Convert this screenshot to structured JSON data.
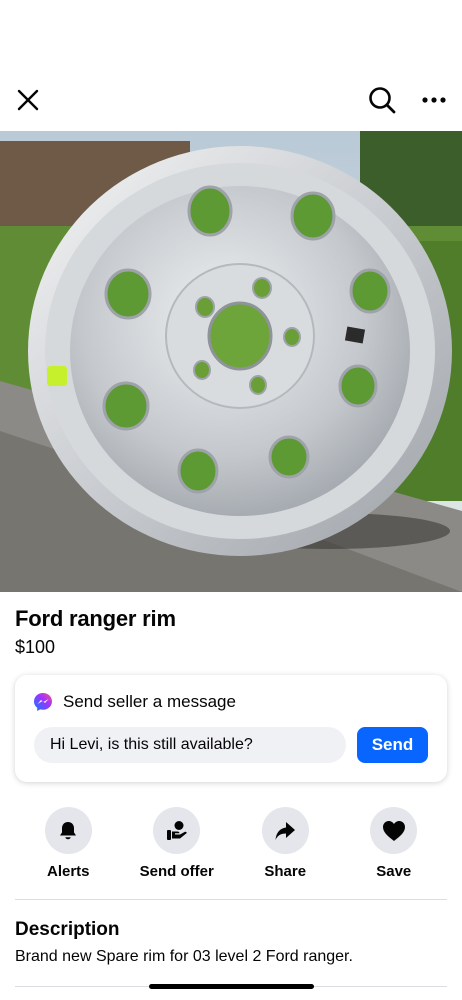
{
  "header": {
    "close_icon": "close-icon",
    "search_icon": "search-icon",
    "more_icon": "more-options-icon"
  },
  "photo": {
    "alt": "Aluminum wheel rim on pavement",
    "page_count": 2,
    "current_page": 1
  },
  "listing": {
    "title": "Ford ranger rim",
    "price": "$100"
  },
  "message": {
    "heading": "Send seller a message",
    "messenger_icon": "messenger-icon",
    "input_value": "Hi Levi, is this still available?",
    "send_label": "Send",
    "accent": "#0866ff"
  },
  "actions": [
    {
      "label": "Alerts",
      "icon": "bell-icon"
    },
    {
      "label": "Send offer",
      "icon": "offer-icon"
    },
    {
      "label": "Share",
      "icon": "share-icon"
    },
    {
      "label": "Save",
      "icon": "heart-icon"
    }
  ],
  "description": {
    "heading": "Description",
    "text": "Brand new Spare rim for 03 level 2 Ford ranger."
  }
}
